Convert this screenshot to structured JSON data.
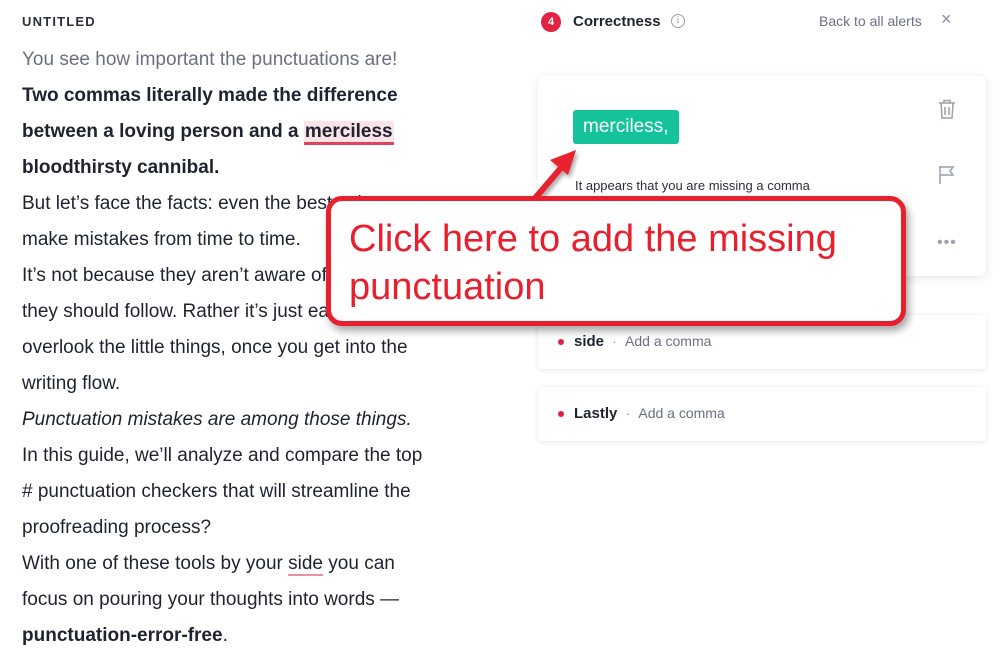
{
  "editor": {
    "title": "UNTITLED",
    "lines": {
      "l1": "You see how important the punctuations are!",
      "l2": "Two commas literally made the difference",
      "l3_pre": "between a loving person and a ",
      "l3_err": "merciless",
      "l4": "bloodthirsty cannibal.",
      "l5": "But let’s face the facts: even the best writers",
      "l6": "make mistakes from time to time.",
      "l7": "It’s not because they aren’t aware of the rules",
      "l8": "they should follow. Rather it’s just easy to",
      "l9": "overlook the little things, once you get into the",
      "l10": "writing flow.",
      "l11": "Punctuation mistakes are among those things.",
      "l12": "In this guide, we’ll analyze and compare the top",
      "l13": "# punctuation checkers that will streamline the",
      "l14": "proofreading process?",
      "l15_pre": "With one of these tools by your ",
      "l15_err": "side",
      "l15_post": " you can",
      "l16": "focus on pouring your thoughts into words —",
      "l17_b": "punctuation-error-free",
      "l17_post": "."
    }
  },
  "sidebar": {
    "alert_count": "4",
    "title": "Correctness",
    "info_icon": "info-icon",
    "back_label": "Back to all alerts",
    "close_glyph": "×",
    "main_card": {
      "suggestion": "merciless,",
      "description": "It appears that you are missing a comma",
      "icons": [
        "trash-icon",
        "flag-icon",
        "more-icon"
      ]
    },
    "alerts": [
      {
        "word": "side",
        "separator": "·",
        "hint": "Add a comma"
      },
      {
        "word": "Lastly",
        "separator": "·",
        "hint": "Add a comma"
      }
    ]
  },
  "annotation": {
    "text_line1": "Click here to add the missing",
    "text_line2": "punctuation",
    "color": "#e8202d"
  },
  "colors": {
    "accent_green": "#15c39a",
    "error_red": "#e22243",
    "error_underline": "#e4415c"
  }
}
